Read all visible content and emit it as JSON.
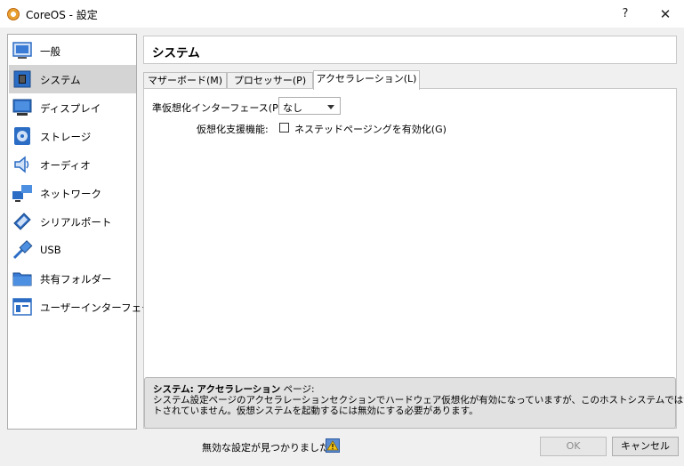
{
  "window": {
    "title": "CoreOS - 設定",
    "help": "?",
    "close": "✕"
  },
  "sidebar": {
    "items": [
      {
        "label": "一般",
        "icon": "general-icon"
      },
      {
        "label": "システム",
        "icon": "system-icon",
        "selected": true
      },
      {
        "label": "ディスプレイ",
        "icon": "display-icon"
      },
      {
        "label": "ストレージ",
        "icon": "storage-icon"
      },
      {
        "label": "オーディオ",
        "icon": "audio-icon"
      },
      {
        "label": "ネットワーク",
        "icon": "network-icon"
      },
      {
        "label": "シリアルポート",
        "icon": "serial-port-icon"
      },
      {
        "label": "USB",
        "icon": "usb-icon"
      },
      {
        "label": "共有フォルダー",
        "icon": "shared-folder-icon"
      },
      {
        "label": "ユーザーインターフェース",
        "icon": "user-interface-icon"
      }
    ]
  },
  "page": {
    "title": "システム"
  },
  "tabs": [
    {
      "label": "マザーボード(M)"
    },
    {
      "label": "プロセッサー(P)"
    },
    {
      "label": "アクセラレーション(L)",
      "active": true
    }
  ],
  "acceleration": {
    "paravirt_label": "準仮想化インターフェース(P):",
    "paravirt_value": "なし",
    "hwvirt_label": "仮想化支援機能:",
    "nested_paging_label": "ネステッドページングを有効化(G)",
    "nested_paging_checked": false
  },
  "info": {
    "title_bold": "システム: アクセラレーション",
    "title_suffix": " ページ:",
    "line1": "システム設定ページのアクセラレーションセクションでハードウェア仮想化が有効になっていますが、このホストシステムではサポー",
    "line2": "トされていません。仮想システムを起動するには無効にする必要があります。"
  },
  "footer": {
    "warning_text": "無効な設定が見つかりました",
    "ok_label": "OK",
    "cancel_label": "キャンセル"
  },
  "colors": {
    "selection": "#d4d4d4",
    "icon_blue": "#2b6cc4"
  }
}
